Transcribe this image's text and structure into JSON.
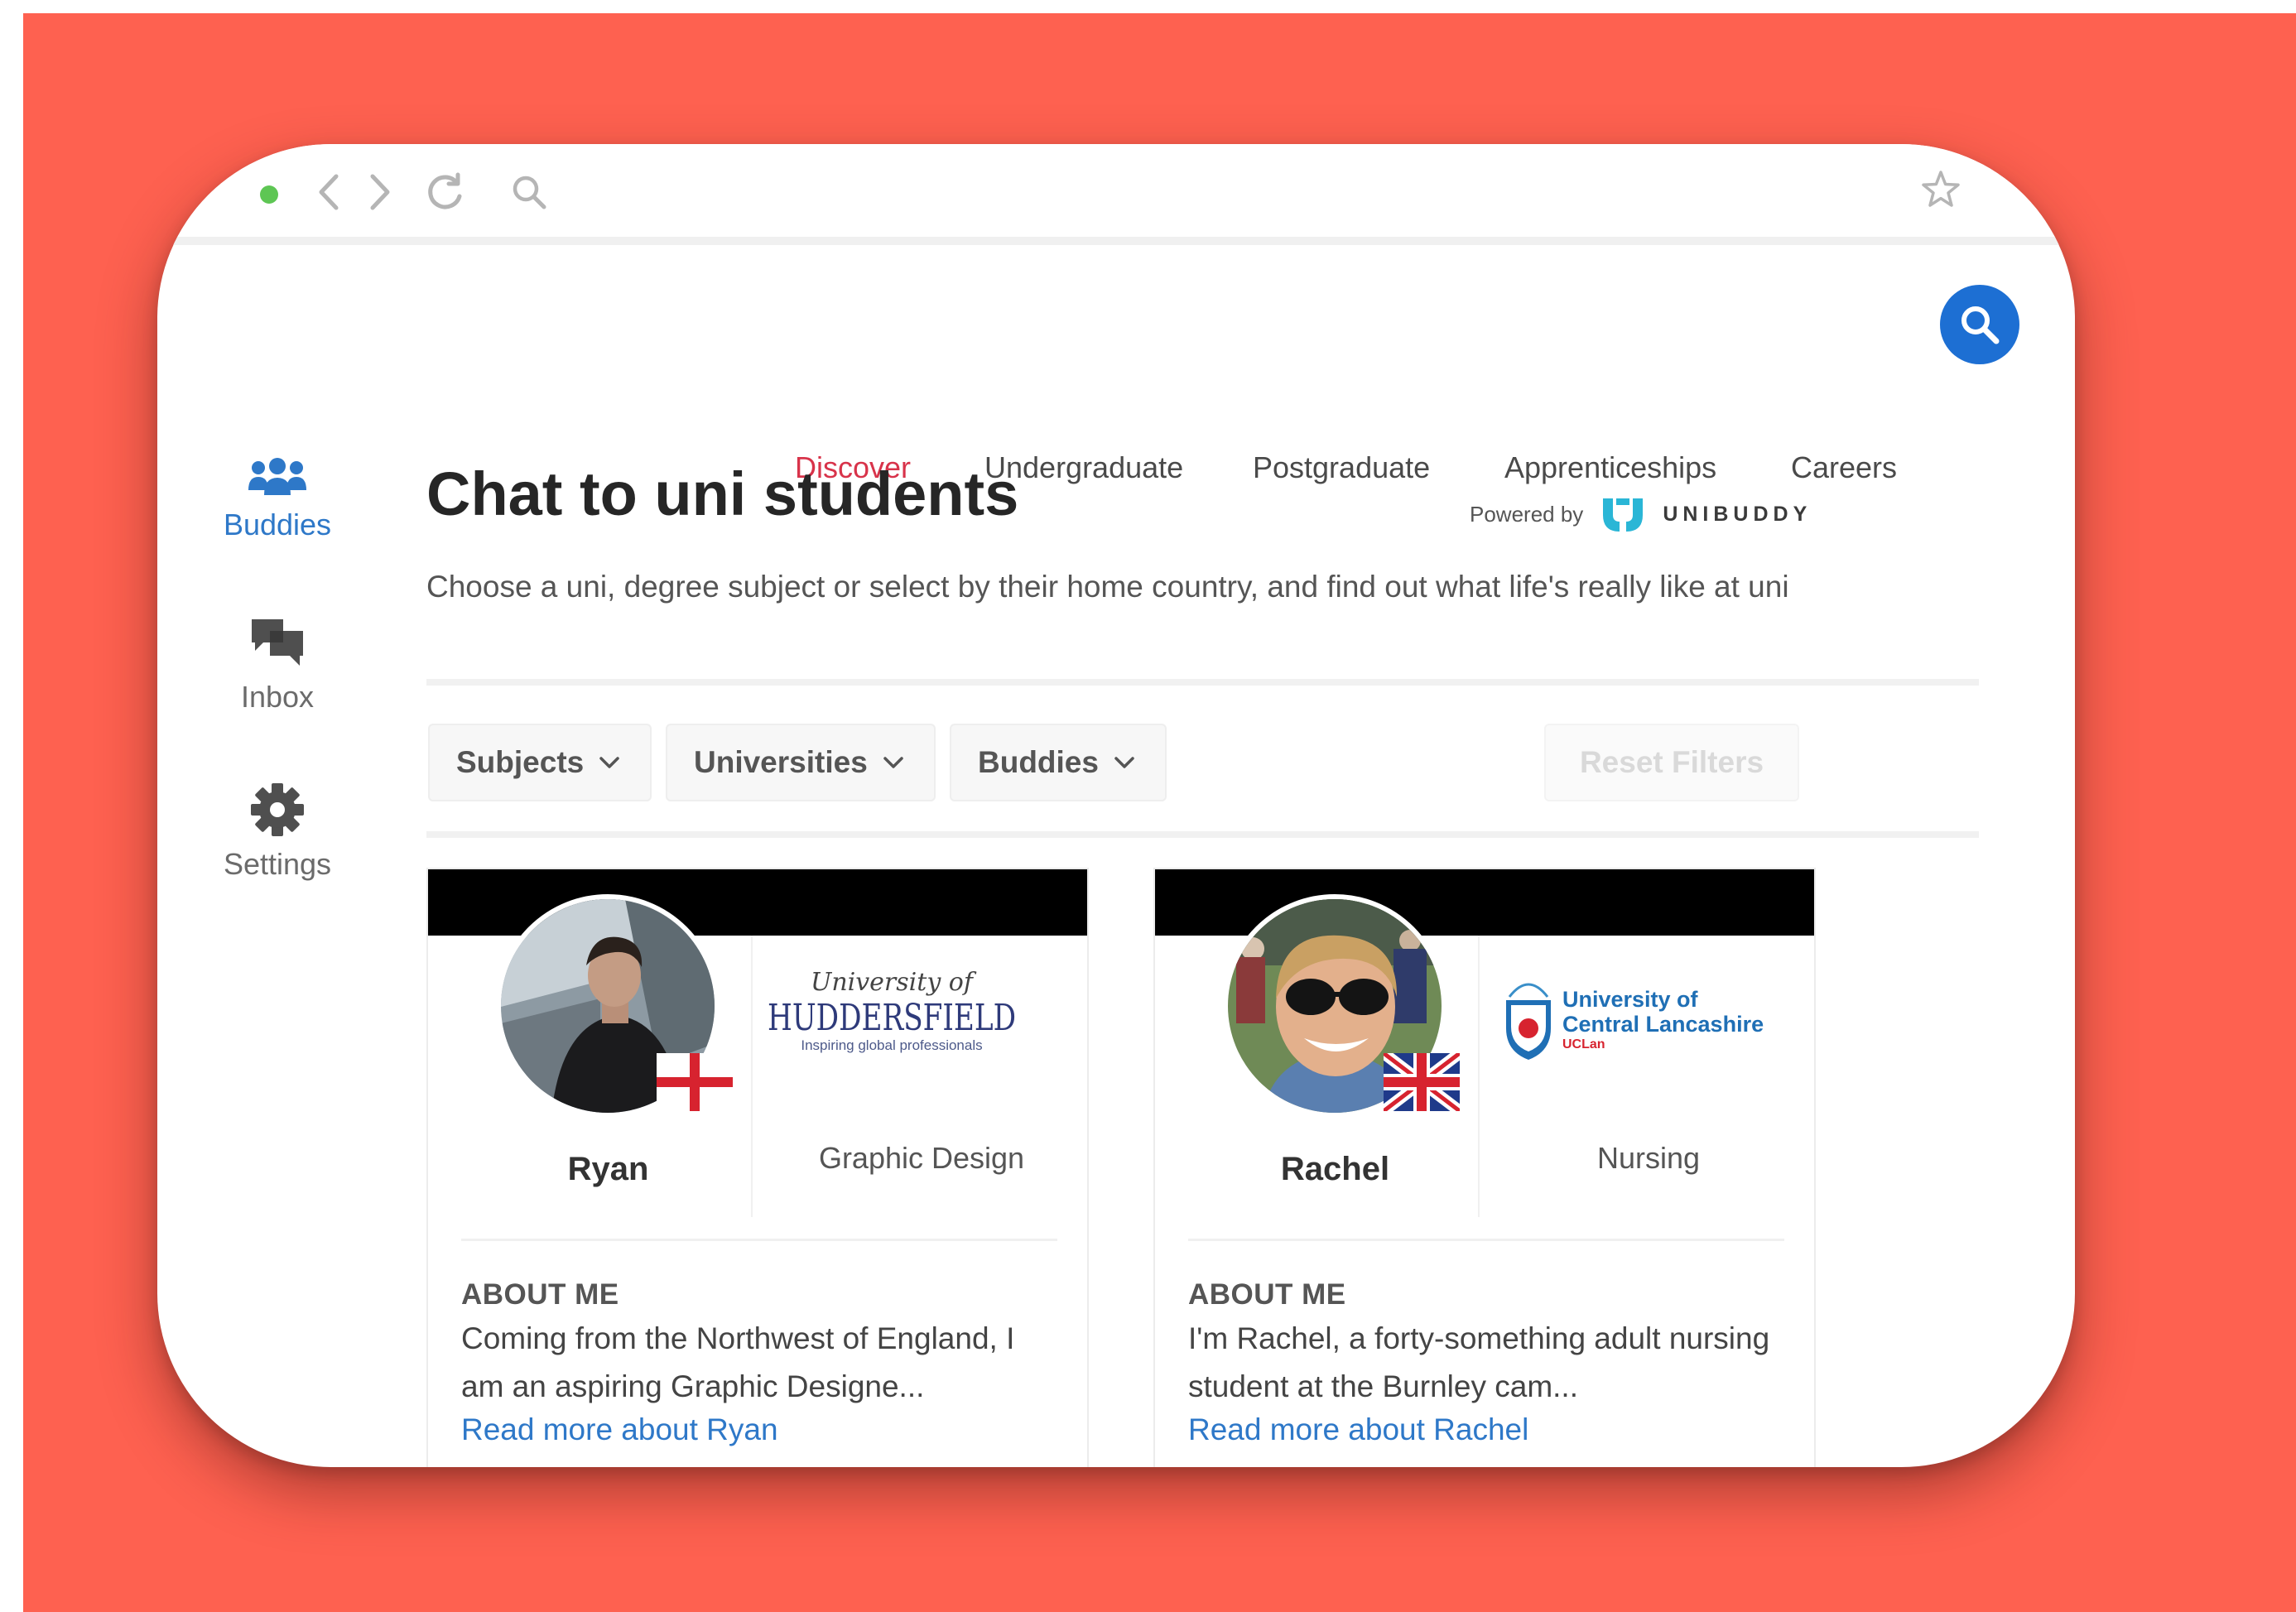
{
  "colors": {
    "background": "#fe6150",
    "accent_red": "#d8334a",
    "accent_blue": "#1d6fd3",
    "link_blue": "#2e78c8"
  },
  "browser": {
    "icons": [
      "window-dot",
      "back-arrow-icon",
      "forward-arrow-icon",
      "reload-icon",
      "search-icon",
      "bookmark-star-icon"
    ]
  },
  "nav": {
    "items": [
      "Discover",
      "Undergraduate",
      "Postgraduate",
      "Apprenticeships",
      "Careers"
    ],
    "active": "Discover",
    "search_icon": "search-icon"
  },
  "sidebar": {
    "items": [
      {
        "label": "Buddies",
        "icon": "people-group-icon",
        "active": true
      },
      {
        "label": "Inbox",
        "icon": "chat-bubbles-icon",
        "active": false
      },
      {
        "label": "Settings",
        "icon": "gear-icon",
        "active": false
      }
    ]
  },
  "main": {
    "title": "Chat to uni students",
    "powered_by": "Powered by",
    "brand": "UNIBUDDY",
    "description": "Choose a uni, degree subject or select by their home country, and find out what life's really like at uni"
  },
  "filters": {
    "subjects": "Subjects",
    "universities": "Universities",
    "buddies": "Buddies",
    "reset": "Reset Filters"
  },
  "cards": [
    {
      "name": "Ryan",
      "flag": "england-flag",
      "university_logo": {
        "line1": "University of",
        "line2": "HUDDERSFIELD",
        "line3": "Inspiring global professionals"
      },
      "subject": "Graphic Design",
      "about_heading": "ABOUT ME",
      "about": "Coming from the Northwest of England, I am an aspiring Graphic Designe...",
      "read_more": "Read more about Ryan"
    },
    {
      "name": "Rachel",
      "flag": "uk-flag",
      "university_logo": {
        "line1": "University of",
        "line2": "Central Lancashire",
        "line3": "UCLan"
      },
      "subject": "Nursing",
      "about_heading": "ABOUT ME",
      "about": "I'm Rachel, a forty-something adult nursing student at the Burnley cam...",
      "read_more": "Read more about Rachel"
    }
  ]
}
